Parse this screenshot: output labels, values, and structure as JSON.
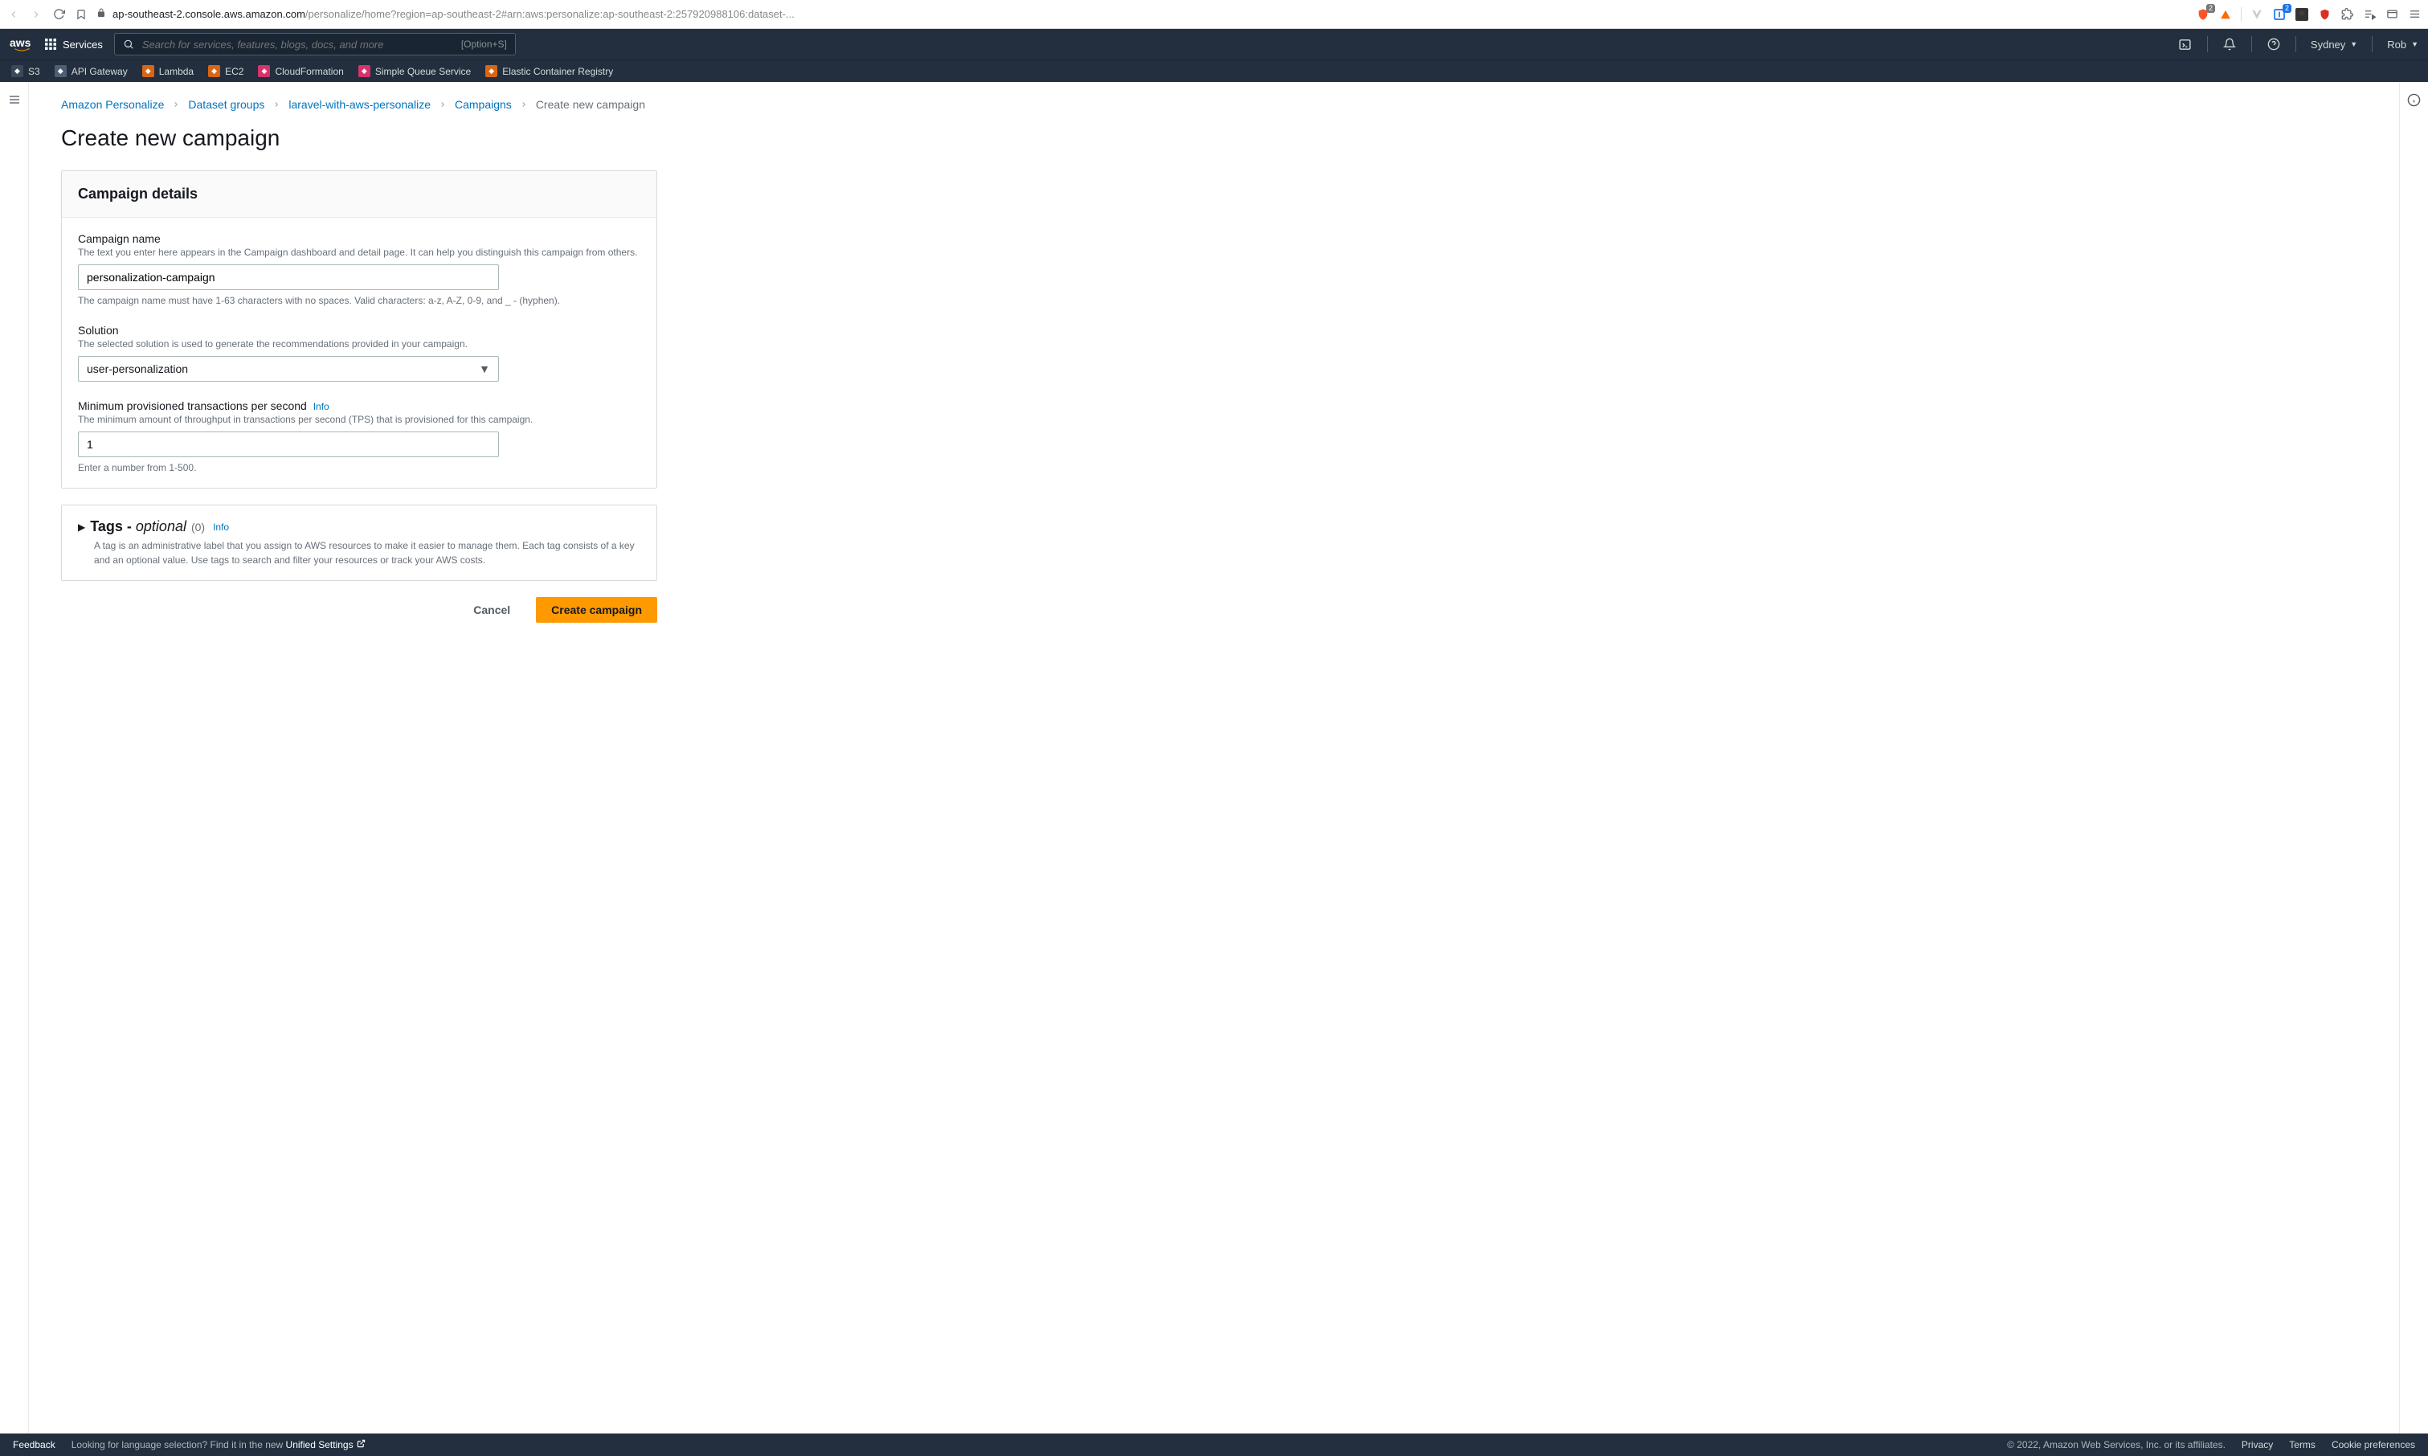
{
  "browser": {
    "url_host": "ap-southeast-2.console.aws.amazon.com",
    "url_path": "/personalize/home?region=ap-southeast-2#arn:aws:personalize:ap-southeast-2:257920988106:dataset-...",
    "brave_badge": "2",
    "blue_badge": "2"
  },
  "topbar": {
    "services_label": "Services",
    "search_placeholder": "Search for services, features, blogs, docs, and more",
    "search_shortcut": "[Option+S]",
    "region": "Sydney",
    "user": "Rob"
  },
  "shortcuts": [
    {
      "label": "S3",
      "cls": "s3"
    },
    {
      "label": "API Gateway",
      "cls": "apigw"
    },
    {
      "label": "Lambda",
      "cls": "lambda"
    },
    {
      "label": "EC2",
      "cls": "ec2"
    },
    {
      "label": "CloudFormation",
      "cls": "cfn"
    },
    {
      "label": "Simple Queue Service",
      "cls": "sqs"
    },
    {
      "label": "Elastic Container Registry",
      "cls": "ecr"
    }
  ],
  "breadcrumb": {
    "items": [
      "Amazon Personalize",
      "Dataset groups",
      "laravel-with-aws-personalize",
      "Campaigns"
    ],
    "current": "Create new campaign"
  },
  "page_title": "Create new campaign",
  "panel": {
    "title": "Campaign details",
    "name": {
      "label": "Campaign name",
      "desc": "The text you enter here appears in the Campaign dashboard and detail page. It can help you distinguish this campaign from others.",
      "value": "personalization-campaign",
      "help": "The campaign name must have 1-63 characters with no spaces. Valid characters: a-z, A-Z, 0-9, and _ - (hyphen)."
    },
    "solution": {
      "label": "Solution",
      "desc": "The selected solution is used to generate the recommendations provided in your campaign.",
      "value": "user-personalization"
    },
    "tps": {
      "label": "Minimum provisioned transactions per second",
      "info": "Info",
      "desc": "The minimum amount of throughput in transactions per second (TPS) that is provisioned for this campaign.",
      "value": "1",
      "help": "Enter a number from 1-500."
    }
  },
  "tags": {
    "title_prefix": "Tags - ",
    "optional": "optional",
    "count": "(0)",
    "info": "Info",
    "desc": "A tag is an administrative label that you assign to AWS resources to make it easier to manage them. Each tag consists of a key and an optional value. Use tags to search and filter your resources or track your AWS costs."
  },
  "actions": {
    "cancel": "Cancel",
    "create": "Create campaign"
  },
  "footer": {
    "feedback": "Feedback",
    "lang_prefix": "Looking for language selection? Find it in the new ",
    "unified": "Unified Settings",
    "copyright": "© 2022, Amazon Web Services, Inc. or its affiliates.",
    "privacy": "Privacy",
    "terms": "Terms",
    "cookies": "Cookie preferences"
  }
}
